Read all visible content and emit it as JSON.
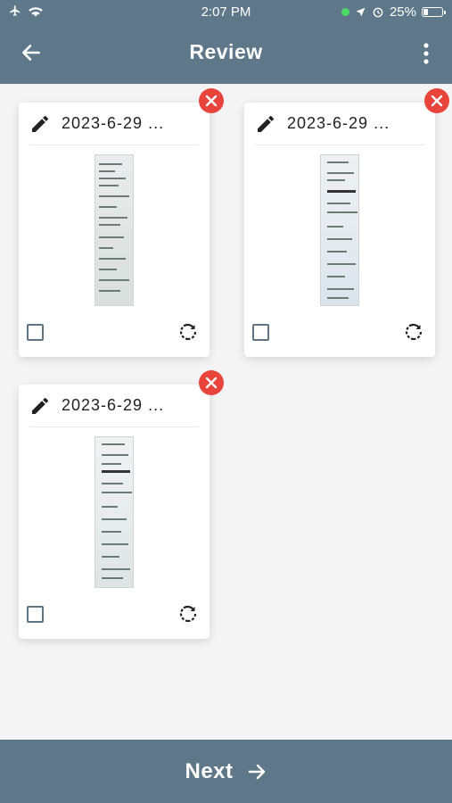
{
  "status_bar": {
    "time": "2:07 PM",
    "battery": "25%",
    "battery_level": 0.25,
    "icons": [
      "airplane-icon",
      "wifi-icon",
      "location-icon",
      "alarm-icon",
      "battery-icon"
    ]
  },
  "header": {
    "title": "Review",
    "back_icon": "arrow-left-icon",
    "menu_icon": "more-vertical-icon"
  },
  "cards": [
    {
      "date": "2023-6-29 ...",
      "checked": false
    },
    {
      "date": "2023-6-29 ...",
      "checked": false
    },
    {
      "date": "2023-6-29 ...",
      "checked": false
    }
  ],
  "footer": {
    "next_label": "Next",
    "next_icon": "arrow-right-icon"
  },
  "colors": {
    "primary": "#5e7889",
    "delete": "#e8443c",
    "background": "#f4f4f4"
  }
}
